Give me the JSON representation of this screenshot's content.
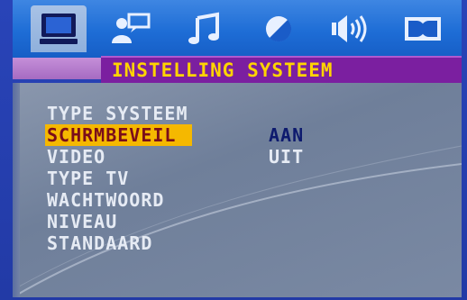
{
  "tabs": [
    {
      "icon": "monitor-icon",
      "active": true
    },
    {
      "icon": "language-person-icon",
      "active": false
    },
    {
      "icon": "music-note-icon",
      "active": false
    },
    {
      "icon": "color-adjust-icon",
      "active": false
    },
    {
      "icon": "speaker-audio-icon",
      "active": false
    },
    {
      "icon": "dolby-icon",
      "active": false
    }
  ],
  "title": "INSTELLING SYSTEEM",
  "menu": [
    {
      "label": "TYPE SYSTEEM",
      "selected": false
    },
    {
      "label": "SCHRMBEVEIL",
      "selected": true
    },
    {
      "label": "VIDEO",
      "selected": false
    },
    {
      "label": "TYPE TV",
      "selected": false
    },
    {
      "label": "WACHTWOORD",
      "selected": false
    },
    {
      "label": "NIVEAU",
      "selected": false
    },
    {
      "label": "STANDAARD",
      "selected": false
    }
  ],
  "options": {
    "on": "AAN",
    "off": "UIT"
  },
  "colors": {
    "accent": "#f5b800",
    "title_text": "#ffd400",
    "title_bg": "#7b1fa0"
  }
}
